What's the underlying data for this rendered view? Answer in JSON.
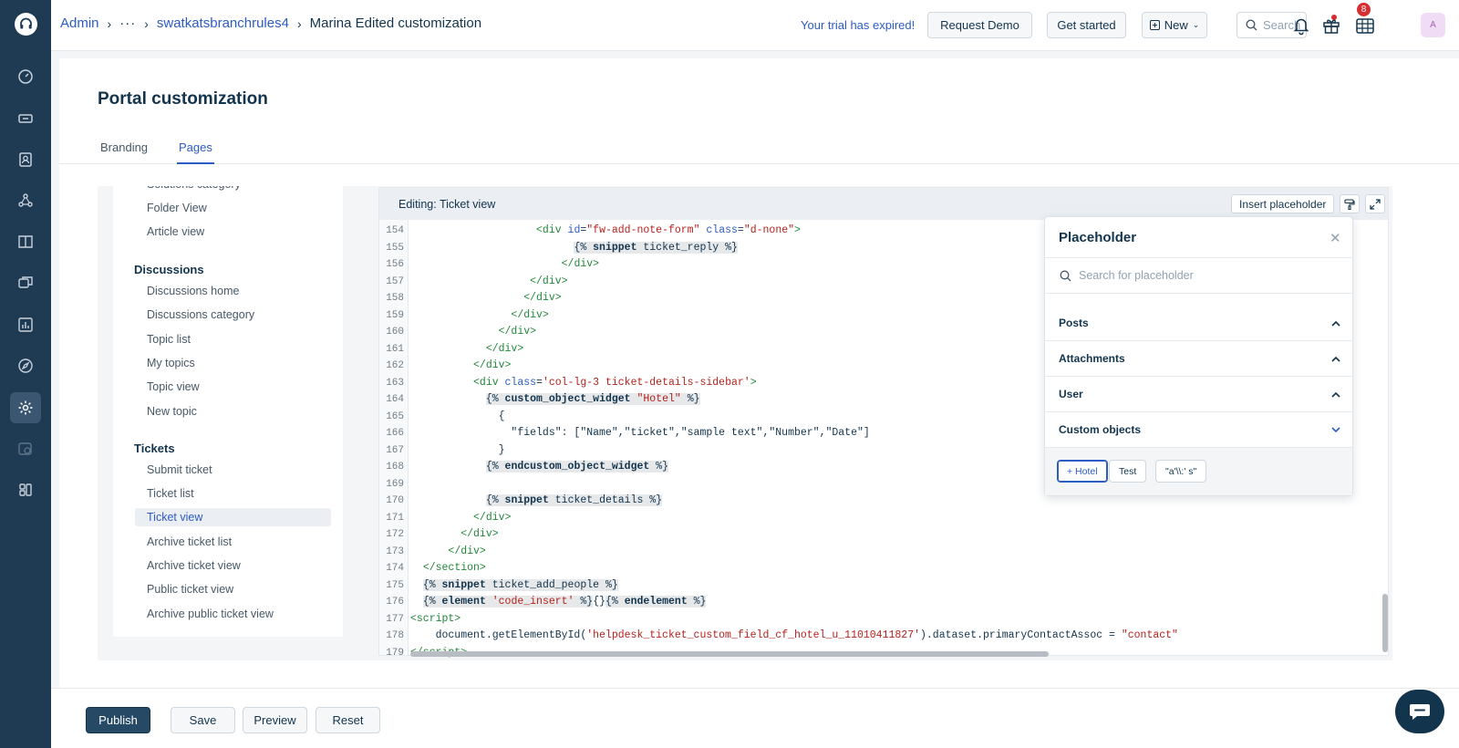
{
  "breadcrumb": {
    "admin": "Admin",
    "ellipsis": "···",
    "branch": "swatkatsbranchrules4",
    "current": "Marina Edited customization"
  },
  "topbar": {
    "trial_text": "Your trial has expired!",
    "request_demo": "Request Demo",
    "get_started": "Get started",
    "new_label": "New",
    "search_placeholder": "Search",
    "gift_badge": "8",
    "avatar_initial": "A"
  },
  "page": {
    "title": "Portal customization",
    "tabs": [
      "Branding",
      "Pages"
    ]
  },
  "leftnav": {
    "partial_top": "Solutions category",
    "items_solutions": [
      "Folder View",
      "Article view"
    ],
    "discussions_title": "Discussions",
    "items_discussions": [
      "Discussions home",
      "Discussions category",
      "Topic list",
      "My topics",
      "Topic view",
      "New topic"
    ],
    "tickets_title": "Tickets",
    "items_tickets": [
      "Submit ticket",
      "Ticket list",
      "Ticket view",
      "Archive ticket list",
      "Archive ticket view",
      "Public ticket view",
      "Archive public ticket view"
    ]
  },
  "editor": {
    "title": "Editing: Ticket view",
    "insert_placeholder": "Insert placeholder"
  },
  "placeholder_panel": {
    "title": "Placeholder",
    "search_placeholder": "Search for placeholder",
    "sections": [
      "Posts",
      "Attachments",
      "User",
      "Custom objects"
    ],
    "chips": [
      "+ Hotel",
      "Test",
      "\"a'\\\\:' s\""
    ]
  },
  "footer": {
    "publish": "Publish",
    "save": "Save",
    "preview": "Preview",
    "reset": "Reset"
  },
  "colors": {
    "rail": "#1f3a53",
    "accent": "#2c5cc5",
    "primary_button": "#264966",
    "badge": "#d72d30"
  }
}
